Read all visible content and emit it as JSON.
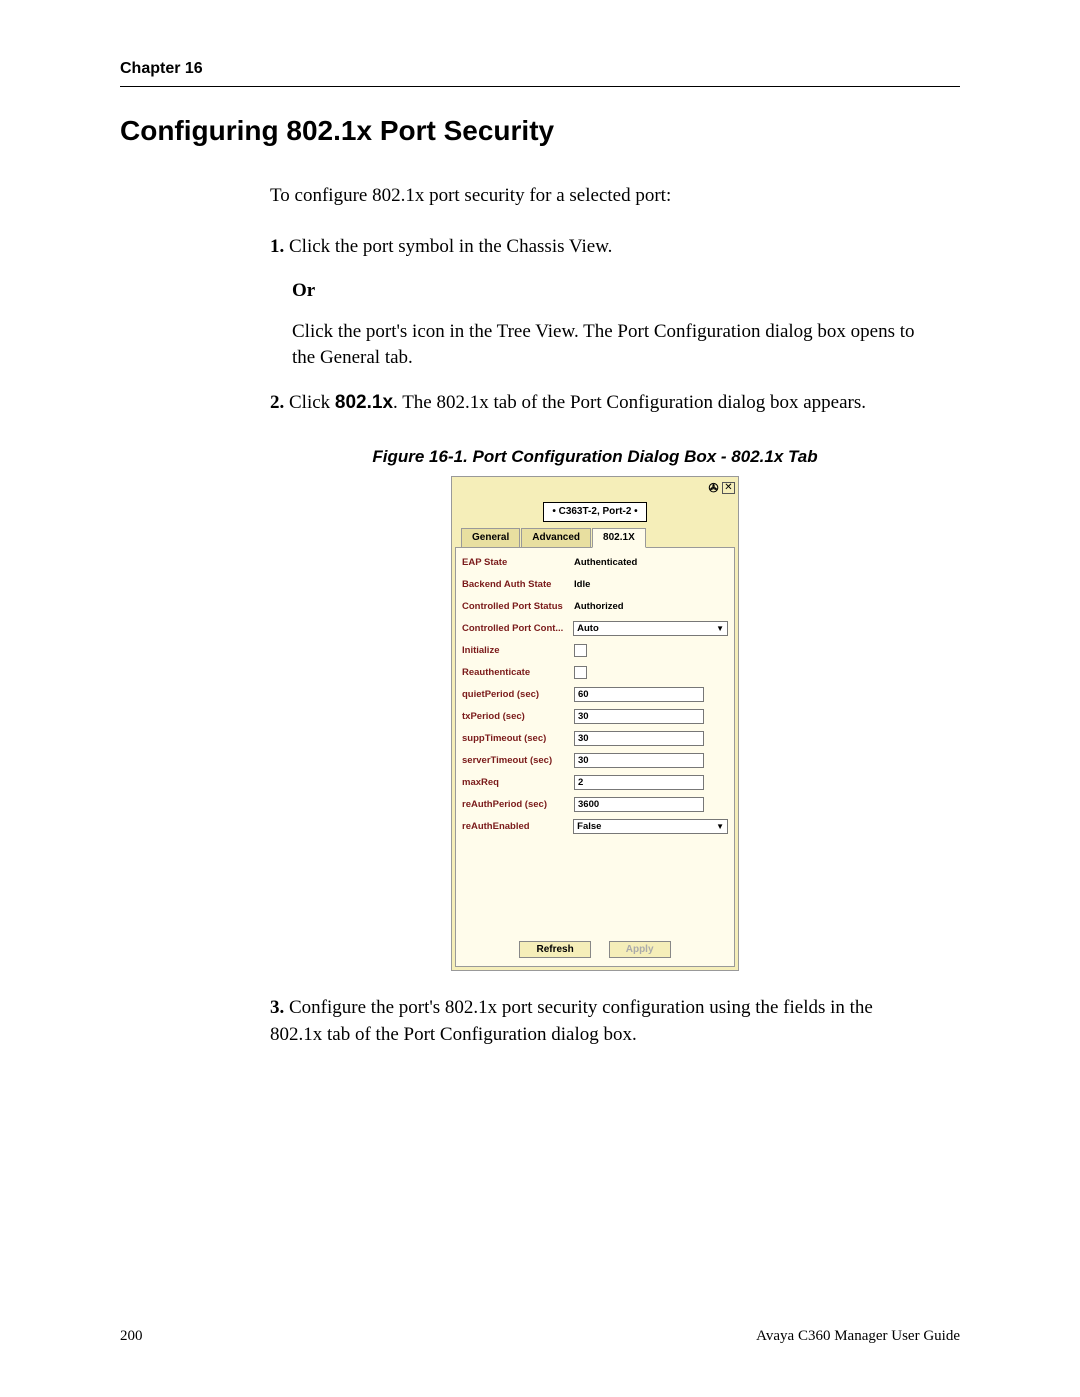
{
  "header": {
    "chapter": "Chapter 16"
  },
  "section": {
    "title": "Configuring 802.1x Port Security",
    "intro": "To configure 802.1x port security for a selected port:",
    "steps": {
      "s1_num": "1.",
      "s1_text": "Click the port symbol in the Chassis View.",
      "or_label": "Or",
      "s1_alt": "Click the port's icon in the Tree View. The Port Configuration dialog box opens to the General tab.",
      "s2_num": "2.",
      "s2_prefix": "Click ",
      "s2_bold": "802.1x",
      "s2_suffix": ". The 802.1x tab of the Port Configuration dialog box appears.",
      "s3_num": "3.",
      "s3_text": "Configure the port's 802.1x port security configuration using the fields in the 802.1x tab of the Port Configuration dialog box."
    },
    "figure_caption": "Figure 16-1. Port Configuration Dialog Box - 802.1x Tab"
  },
  "dialog": {
    "breadcrumb": "• C363T-2, Port-2 •",
    "tabs": {
      "general": "General",
      "advanced": "Advanced",
      "x8021": "802.1X"
    },
    "fields": {
      "eap_state_label": "EAP State",
      "eap_state_value": "Authenticated",
      "backend_label": "Backend Auth State",
      "backend_value": "Idle",
      "cps_label": "Controlled Port Status",
      "cps_value": "Authorized",
      "cpc_label": "Controlled Port Cont...",
      "cpc_value": "Auto",
      "initialize_label": "Initialize",
      "reauth_label": "Reauthenticate",
      "quiet_label": "quietPeriod (sec)",
      "quiet_value": "60",
      "tx_label": "txPeriod (sec)",
      "tx_value": "30",
      "supp_label": "suppTimeout (sec)",
      "supp_value": "30",
      "server_label": "serverTimeout (sec)",
      "server_value": "30",
      "maxreq_label": "maxReq",
      "maxreq_value": "2",
      "reauthper_label": "reAuthPeriod (sec)",
      "reauthper_value": "3600",
      "reauthen_label": "reAuthEnabled",
      "reauthen_value": "False"
    },
    "buttons": {
      "refresh": "Refresh",
      "apply": "Apply"
    }
  },
  "footer": {
    "page_num": "200",
    "doc_title": "Avaya C360 Manager User Guide"
  }
}
